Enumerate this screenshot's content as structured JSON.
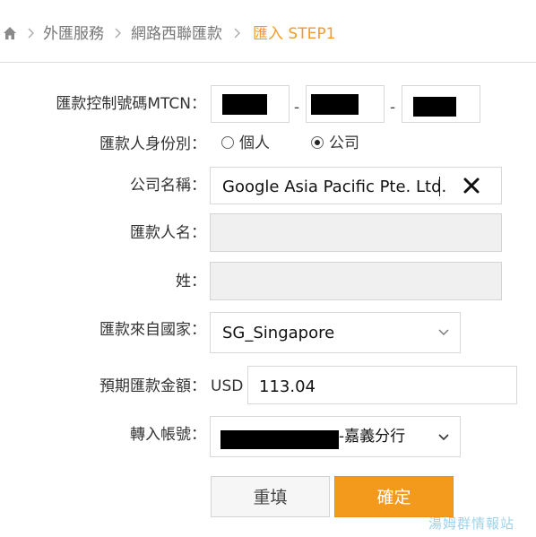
{
  "breadcrumb": {
    "home_icon": "home-icon",
    "items": [
      "外匯服務",
      "網路西聯匯款",
      "匯入 STEP1"
    ]
  },
  "form": {
    "mtcn": {
      "label": "匯款控制號碼MTCN：",
      "separator": "-"
    },
    "identity": {
      "label": "匯款人身份別：",
      "options": [
        "個人",
        "公司"
      ],
      "selected": "公司"
    },
    "company": {
      "label": "公司名稱：",
      "value": "Google Asia Pacific Pte. Ltd.",
      "clear_icon": "close-icon"
    },
    "remitter_name": {
      "label": "匯款人名：",
      "value": ""
    },
    "surname": {
      "label": "姓：",
      "value": ""
    },
    "country": {
      "label": "匯款來自國家：",
      "value": "SG_Singapore"
    },
    "amount": {
      "label": "預期匯款金額：",
      "currency": "USD",
      "value": "113.04"
    },
    "account": {
      "label": "轉入帳號：",
      "suffix": "-嘉義分行"
    }
  },
  "buttons": {
    "reset": "重填",
    "submit": "確定"
  },
  "watermark": "湯姆群情報站",
  "colors": {
    "accent": "#f39a1d",
    "breadcrumb_current": "#f39a2b",
    "disabled_bg": "#f0f0f0"
  }
}
